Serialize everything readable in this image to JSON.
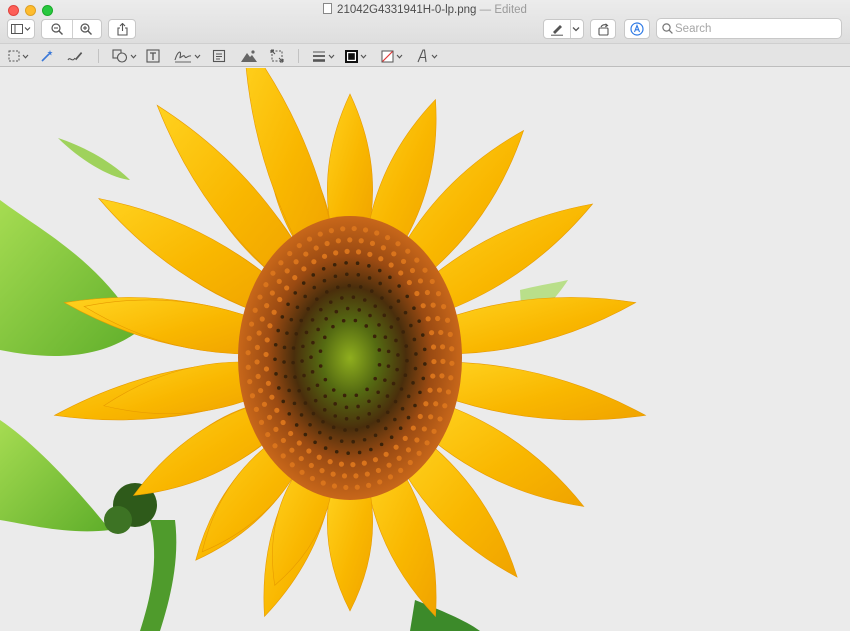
{
  "window": {
    "filename": "21042G4331941H-0-lp.png",
    "status": "Edited",
    "separator": " — "
  },
  "search": {
    "placeholder": "Search"
  },
  "toolbar": {
    "icons": [
      "sidebar-icon",
      "zoom-out-icon",
      "zoom-in-icon",
      "share-icon",
      "markup-pen-icon",
      "rotate-icon",
      "markup-toolbar-icon",
      "search-icon"
    ]
  },
  "markup_tools": [
    "rectangular-selection-icon",
    "instant-alpha-icon",
    "sketch-icon",
    "shapes-icon",
    "text-icon",
    "sign-icon",
    "note-icon",
    "adjust-color-icon",
    "adjust-size-icon",
    "shape-style-icon",
    "border-color-icon",
    "fill-color-icon",
    "text-style-icon"
  ],
  "image": {
    "subject": "sunflower"
  },
  "colors": {
    "petal": "#f7b500",
    "center": "#7a3b10",
    "leaf": "#7cc63a",
    "background": "#ebebeb"
  }
}
